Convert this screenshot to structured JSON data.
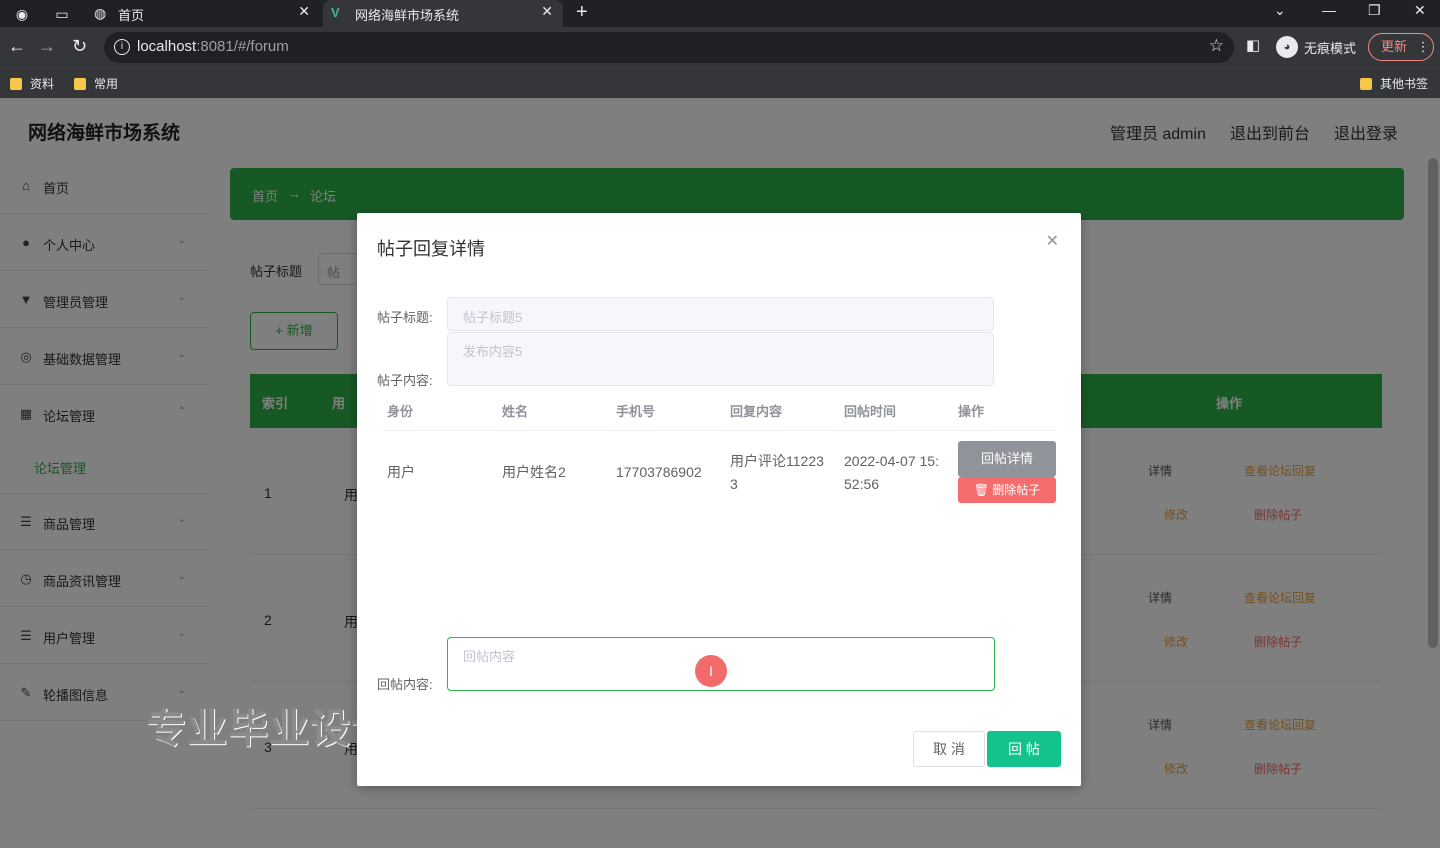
{
  "browser": {
    "tabs": [
      {
        "title": "首页"
      },
      {
        "title": "网络海鲜市场系统"
      }
    ],
    "url_host": "localhost",
    "url_rest": ":8081/#/forum",
    "incognito_label": "无痕模式",
    "update_label": "更新",
    "bookmarks": [
      "资料",
      "常用"
    ],
    "other_bookmarks": "其他书签"
  },
  "header": {
    "title": "网络海鲜市场系统",
    "user": "管理员 admin",
    "back_to_front": "退出到前台",
    "logout": "退出登录"
  },
  "sidebar": {
    "items": [
      {
        "label": "首页",
        "icon": "home-icon"
      },
      {
        "label": "个人中心",
        "icon": "user-icon"
      },
      {
        "label": "管理员管理",
        "icon": "admin-icon"
      },
      {
        "label": "基础数据管理",
        "icon": "data-icon"
      },
      {
        "label": "论坛管理",
        "icon": "forum-icon"
      },
      {
        "label": "商品管理",
        "icon": "list-icon"
      },
      {
        "label": "商品资讯管理",
        "icon": "clock-icon"
      },
      {
        "label": "用户管理",
        "icon": "list-icon"
      },
      {
        "label": "轮播图信息",
        "icon": "image-icon"
      }
    ],
    "sub_item": "论坛管理"
  },
  "breadcrumb": {
    "home": "首页",
    "arrow": "→",
    "current": "论坛"
  },
  "search": {
    "label": "帖子标题",
    "placeholder": "帖"
  },
  "add_button": "+ 新增",
  "table": {
    "headers": {
      "index": "索引",
      "col2": "用",
      "actions": "操作"
    },
    "rows": [
      {
        "index": "1",
        "who": "用"
      },
      {
        "index": "2",
        "who": "用"
      },
      {
        "index": "3",
        "who": "用"
      }
    ],
    "actions": {
      "detail": "详情",
      "reset": "查看论坛回复",
      "edit": "修改",
      "delete": "删除帖子"
    }
  },
  "watermark": "专业毕业设计代做",
  "modal": {
    "title": "帖子回复详情",
    "title_label": "帖子标题:",
    "title_value": "帖子标题5",
    "content_label": "帖子内容:",
    "content_value": "发布内容5",
    "reply_table": {
      "headers": [
        "身份",
        "姓名",
        "手机号",
        "回复内容",
        "回帖时间",
        "操作"
      ],
      "rows": [
        {
          "identity": "用户",
          "name": "用户姓名2",
          "phone": "17703786902",
          "content": "用户评论112233",
          "time": "2022-04-07 15:52:56",
          "detail_btn": "回帖详情",
          "delete_btn": "删除帖子"
        }
      ]
    },
    "reply_label": "回帖内容:",
    "reply_placeholder": "回帖内容",
    "cancel": "取 消",
    "submit": "回 帖"
  }
}
